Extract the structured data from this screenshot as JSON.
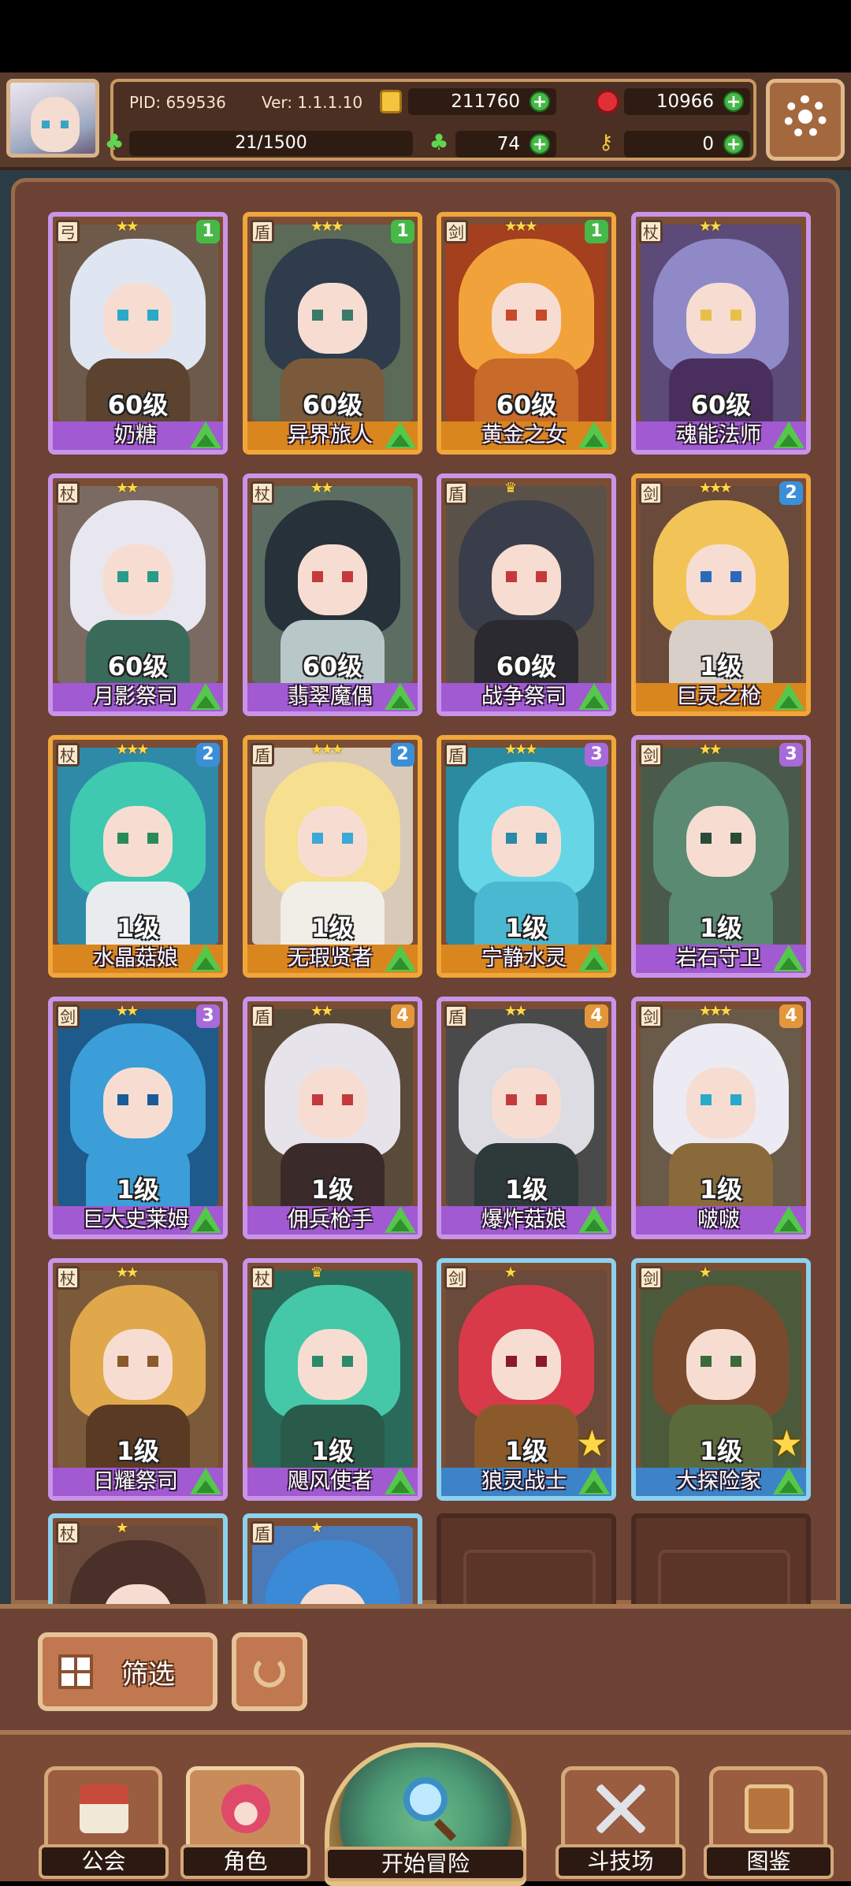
{
  "header": {
    "pid": "PID: 659536",
    "version": "Ver: 1.1.1.10",
    "gold": "211760",
    "gems": "10966",
    "stamina": "21/1500",
    "clover_count": "74",
    "key_count": "0"
  },
  "cards": [
    {
      "name": "奶糖",
      "level": "60级",
      "rank": "1",
      "stars": "★★",
      "frame": "purple",
      "role": "弓"
    },
    {
      "name": "异界旅人",
      "level": "60级",
      "rank": "1",
      "stars": "★★★",
      "frame": "orange",
      "role": "盾"
    },
    {
      "name": "黄金之女",
      "level": "60级",
      "rank": "1",
      "stars": "★★★",
      "frame": "orange",
      "role": "剑"
    },
    {
      "name": "魂能法师",
      "level": "60级",
      "rank": "",
      "stars": "★★",
      "frame": "purple",
      "role": "杖"
    },
    {
      "name": "月影祭司",
      "level": "60级",
      "rank": "",
      "stars": "★★",
      "frame": "purple",
      "role": "杖"
    },
    {
      "name": "翡翠魔偶",
      "level": "60级",
      "rank": "",
      "stars": "★★",
      "frame": "purple",
      "role": "杖"
    },
    {
      "name": "战争祭司",
      "level": "60级",
      "rank": "",
      "stars": "♛",
      "frame": "purple",
      "role": "盾"
    },
    {
      "name": "巨灵之枪",
      "level": "1级",
      "rank": "2",
      "stars": "★★★",
      "frame": "orange",
      "role": "剑"
    },
    {
      "name": "水晶菇娘",
      "level": "1级",
      "rank": "2",
      "stars": "★★★",
      "frame": "orange",
      "role": "杖"
    },
    {
      "name": "无瑕贤者",
      "level": "1级",
      "rank": "2",
      "stars": "★★★",
      "frame": "orange",
      "role": "盾"
    },
    {
      "name": "宁静水灵",
      "level": "1级",
      "rank": "3",
      "stars": "★★★",
      "frame": "orange",
      "role": "盾"
    },
    {
      "name": "岩石守卫",
      "level": "1级",
      "rank": "3",
      "stars": "★★",
      "frame": "purple",
      "role": "剑"
    },
    {
      "name": "巨大史莱姆",
      "level": "1级",
      "rank": "3",
      "stars": "★★",
      "frame": "purple",
      "role": "剑"
    },
    {
      "name": "佣兵枪手",
      "level": "1级",
      "rank": "4",
      "stars": "★★",
      "frame": "purple",
      "role": "盾"
    },
    {
      "name": "爆炸菇娘",
      "level": "1级",
      "rank": "4",
      "stars": "★★",
      "frame": "purple",
      "role": "盾"
    },
    {
      "name": "啵啵",
      "level": "1级",
      "rank": "4",
      "stars": "★★★",
      "frame": "purple",
      "role": "剑"
    },
    {
      "name": "日耀祭司",
      "level": "1级",
      "rank": "",
      "stars": "★★",
      "frame": "purple",
      "role": "杖"
    },
    {
      "name": "飓风使者",
      "level": "1级",
      "rank": "",
      "stars": "♛",
      "frame": "purple",
      "role": "杖"
    },
    {
      "name": "狼灵战士",
      "level": "1级",
      "rank": "",
      "stars": "★",
      "frame": "blue",
      "role": "剑"
    },
    {
      "name": "大探险家",
      "level": "1级",
      "rank": "",
      "stars": "★",
      "frame": "blue",
      "role": "剑"
    },
    {
      "name": "",
      "level": "",
      "rank": "",
      "stars": "★",
      "frame": "blue",
      "role": "杖"
    },
    {
      "name": "",
      "level": "",
      "rank": "",
      "stars": "★",
      "frame": "blue",
      "role": "盾"
    }
  ],
  "card_colors": [
    {
      "hair": "#dfe6f2",
      "eye": "#2aa9c9",
      "body": "#5b4330",
      "bg": "#6e5a4a"
    },
    {
      "hair": "#2e3c4c",
      "eye": "#3a7a68",
      "body": "#7a5a3a",
      "bg": "#5c6a58"
    },
    {
      "hair": "#f2a23a",
      "eye": "#c84a2a",
      "body": "#c86a2a",
      "bg": "#a4401e"
    },
    {
      "hair": "#8f89c8",
      "eye": "#e7c04a",
      "body": "#4a2f5e",
      "bg": "#5c4a78"
    },
    {
      "hair": "#e8e6ee",
      "eye": "#2a9a8a",
      "body": "#3a6a5a",
      "bg": "#7a6a62"
    },
    {
      "hair": "#27313a",
      "eye": "#c43a3a",
      "body": "#b8c8c8",
      "bg": "#5c6e62"
    },
    {
      "hair": "#3a3e4a",
      "eye": "#c43a3a",
      "body": "#2a2a30",
      "bg": "#5a5248"
    },
    {
      "hair": "#f2c458",
      "eye": "#2a6ab8",
      "body": "#d8d0c8",
      "bg": "#6a4a3a"
    },
    {
      "hair": "#3ec9b0",
      "eye": "#2a8a5a",
      "body": "#e8ecef",
      "bg": "#2f8aa8"
    },
    {
      "hair": "#f6df8e",
      "eye": "#3aa9d8",
      "body": "#f1eee8",
      "bg": "#d8c9b8"
    },
    {
      "hair": "#66d6e6",
      "eye": "#2a8aa8",
      "body": "#4ab8d0",
      "bg": "#2c8aa0"
    },
    {
      "hair": "#5a8a72",
      "eye": "#2a4a3a",
      "body": "#5a8a72",
      "bg": "#4a5a4a"
    },
    {
      "hair": "#3b9ed8",
      "eye": "#1a5a98",
      "body": "#3b9ed8",
      "bg": "#1e5a8a"
    },
    {
      "hair": "#e6e3ea",
      "eye": "#c43a3a",
      "body": "#3a2a2a",
      "bg": "#5a4a3a"
    },
    {
      "hair": "#dcdce2",
      "eye": "#c43a3a",
      "body": "#2e3a3a",
      "bg": "#4a4a4a"
    },
    {
      "hair": "#eceaf2",
      "eye": "#2aa9c9",
      "body": "#8a6a3a",
      "bg": "#6a5a4a"
    },
    {
      "hair": "#e0a84a",
      "eye": "#8a5a2a",
      "body": "#5a3a22",
      "bg": "#7a5a3a"
    },
    {
      "hair": "#45c8a8",
      "eye": "#2a8a6a",
      "body": "#2a5a4a",
      "bg": "#2a6a5a"
    },
    {
      "hair": "#d83a4a",
      "eye": "#8a1a2a",
      "body": "#8a5a2a",
      "bg": "#6a4a3a"
    },
    {
      "hair": "#7a4a2e",
      "eye": "#3a6a3a",
      "body": "#5a6a3a",
      "bg": "#4a5a3a"
    },
    {
      "hair": "#4a3028",
      "eye": "#c43a3a",
      "body": "#3a2a22",
      "bg": "#6a4a3a"
    },
    {
      "hair": "#3a8ad8",
      "eye": "#2a5aa8",
      "body": "#3a6aa8",
      "bg": "#4a7ab8"
    }
  ],
  "filter": {
    "label": "筛选"
  },
  "nav": {
    "guild": "公会",
    "characters": "角色",
    "adventure": "开始冒险",
    "arena": "斗技场",
    "codex": "图鉴"
  }
}
